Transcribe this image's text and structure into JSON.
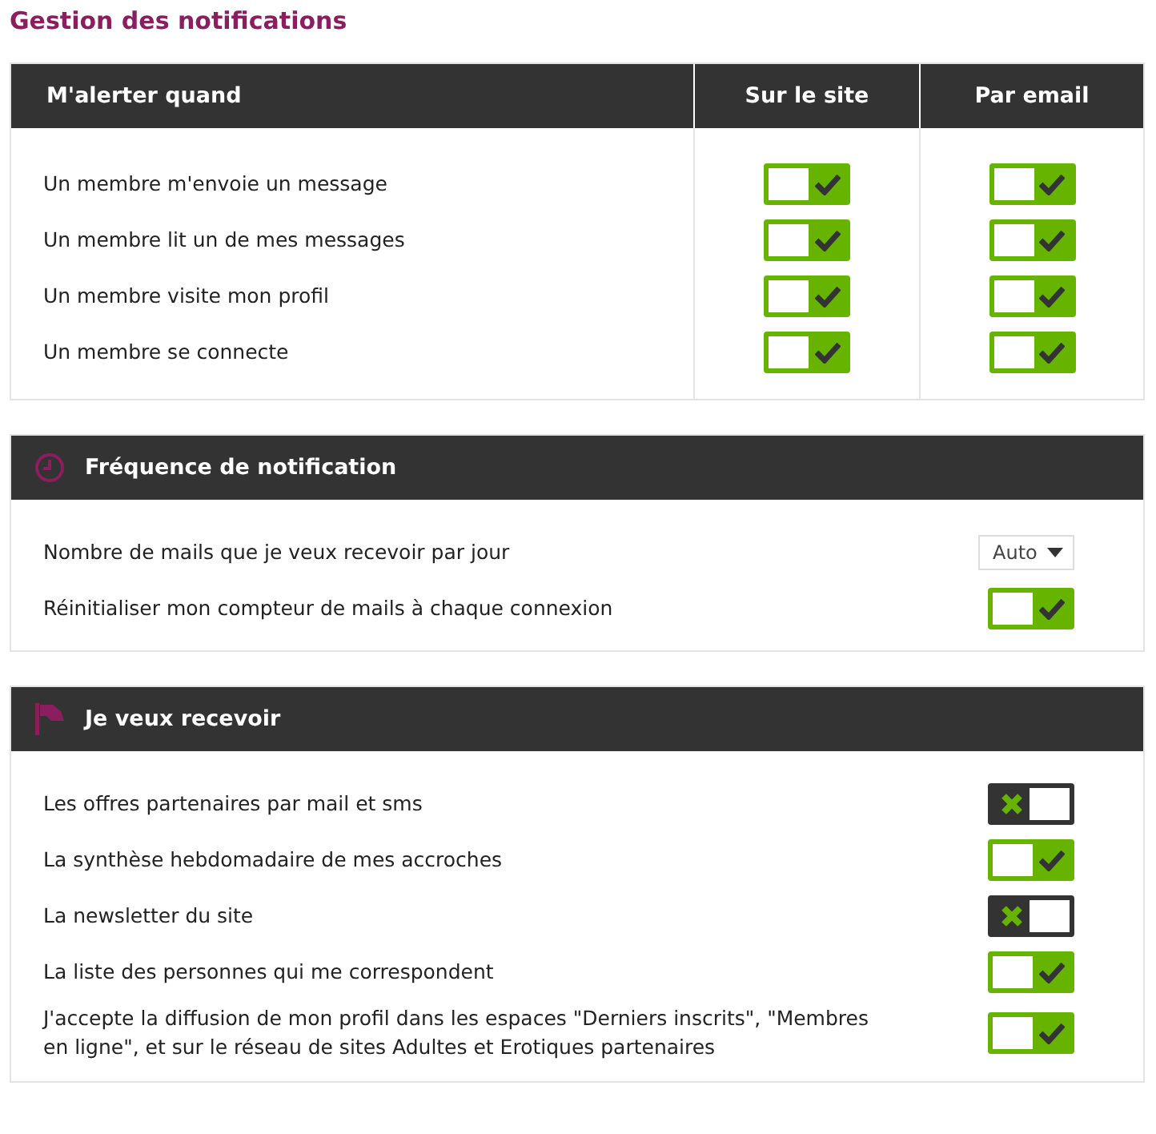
{
  "title": "Gestion des notifications",
  "alerts": {
    "columns": [
      "M'alerter quand",
      "Sur le site",
      "Par email"
    ],
    "rows": [
      {
        "label": "Un membre m'envoie un message",
        "site_on": true,
        "email_on": true
      },
      {
        "label": "Un membre lit un de mes messages",
        "site_on": true,
        "email_on": true
      },
      {
        "label": "Un membre visite mon profil",
        "site_on": true,
        "email_on": true
      },
      {
        "label": "Un membre se connecte",
        "site_on": true,
        "email_on": true
      }
    ]
  },
  "sections": [
    {
      "title": "Fréquence de notification",
      "rows": [
        {
          "kind": "select",
          "label": "Nombre de mails que je veux recevoir par jour",
          "value": "Auto"
        },
        {
          "kind": "toggle",
          "label": "Réinitialiser mon compteur de mails à chaque connexion",
          "on": true
        }
      ]
    },
    {
      "title": "Je veux recevoir",
      "rows": [
        {
          "kind": "toggle",
          "label": "Les offres partenaires par mail et sms",
          "on": false
        },
        {
          "kind": "toggle",
          "label": "La synthèse hebdomadaire de mes accroches",
          "on": true
        },
        {
          "kind": "toggle",
          "label": "La newsletter du site",
          "on": false
        },
        {
          "kind": "toggle",
          "label": "La liste des personnes qui me correspondent",
          "on": true
        },
        {
          "kind": "toggle",
          "label": "J'accepte la diffusion de mon profil dans les espaces \"Derniers inscrits\", \"Membres en ligne\", et sur le réseau de sites Adultes et Erotiques partenaires",
          "on": true
        }
      ]
    }
  ]
}
